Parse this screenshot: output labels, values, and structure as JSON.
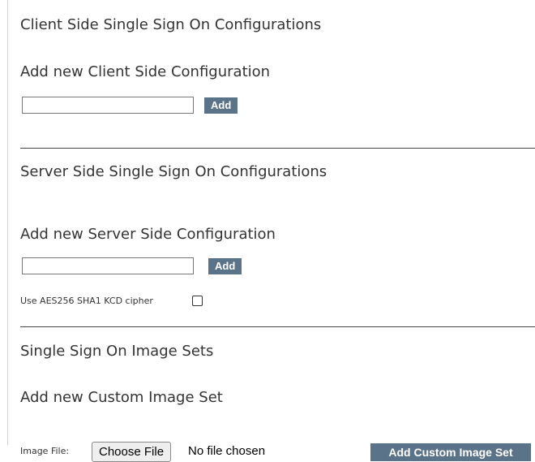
{
  "client": {
    "heading": "Client Side Single Sign On Configurations",
    "subheading": "Add new Client Side Configuration",
    "input_value": "",
    "add_label": "Add"
  },
  "server": {
    "heading": "Server Side Single Sign On Configurations",
    "subheading": "Add new Server Side Configuration",
    "input_value": "",
    "add_label": "Add",
    "cipher_label": "Use AES256 SHA1 KCD cipher",
    "cipher_checked": false
  },
  "image_sets": {
    "heading": "Single Sign On Image Sets",
    "subheading": "Add new Custom Image Set",
    "file_label": "Image File:",
    "choose_label": "Choose File",
    "no_file_text": "No file chosen",
    "add_custom_label": "Add Custom Image Set"
  },
  "colors": {
    "button_bg": "#5b7388",
    "button_text": "#ffffff",
    "text": "#333333",
    "divider": "#444444"
  }
}
